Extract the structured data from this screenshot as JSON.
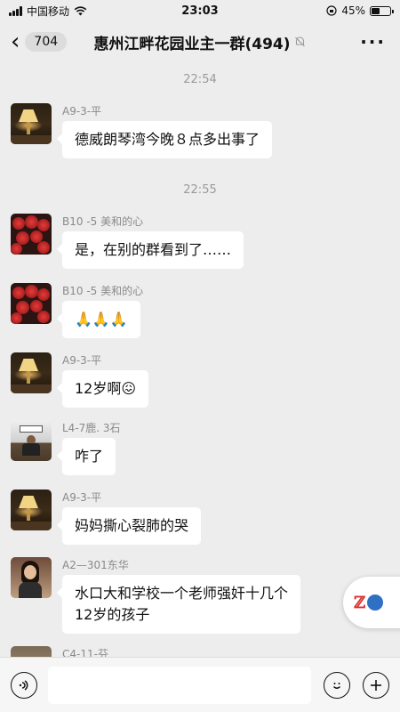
{
  "status_bar": {
    "carrier": "中国移动",
    "time": "23:03",
    "battery_percent": "45%",
    "battery_level": 0.45
  },
  "nav": {
    "back_icon": "chevron-left-icon",
    "unread_count": "704",
    "title": "惠州江畔花园业主一群(494)",
    "mute_icon": "bell-muted-icon",
    "more_icon": "more-icon"
  },
  "chat": {
    "time_dividers": [
      "22:54",
      "22:55"
    ],
    "messages": [
      {
        "sender": "A9-3-平",
        "text": "德威朗琴湾今晚８点多出事了",
        "avatar": "lamp"
      },
      {
        "sender": "B10 -5 美和的心",
        "text": "是，在别的群看到了……",
        "avatar": "rose"
      },
      {
        "sender": "B10 -5 美和的心",
        "text": "🙏🙏🙏",
        "avatar": "rose"
      },
      {
        "sender": "A9-3-平",
        "text": "12岁啊😖",
        "avatar": "lamp"
      },
      {
        "sender": "L4-7鹿. 3石",
        "text": "咋了",
        "avatar": "office"
      },
      {
        "sender": "A9-3-平",
        "text": "妈妈撕心裂肺的哭",
        "avatar": "lamp"
      },
      {
        "sender": "A2—301东华",
        "text_line1": "水口大和学校一个老师强奸十几个",
        "text_line2": "12岁的孩子",
        "avatar": "woman"
      },
      {
        "sender": "C4-11-芬",
        "avatar": "partial"
      }
    ]
  },
  "input_bar": {
    "voice_icon": "voice-icon",
    "emoji_icon": "emoji-icon",
    "plus_icon": "plus-icon"
  },
  "colors": {
    "background": "#ededed",
    "bubble": "#ffffff",
    "meta_text": "#8a8a8a"
  }
}
